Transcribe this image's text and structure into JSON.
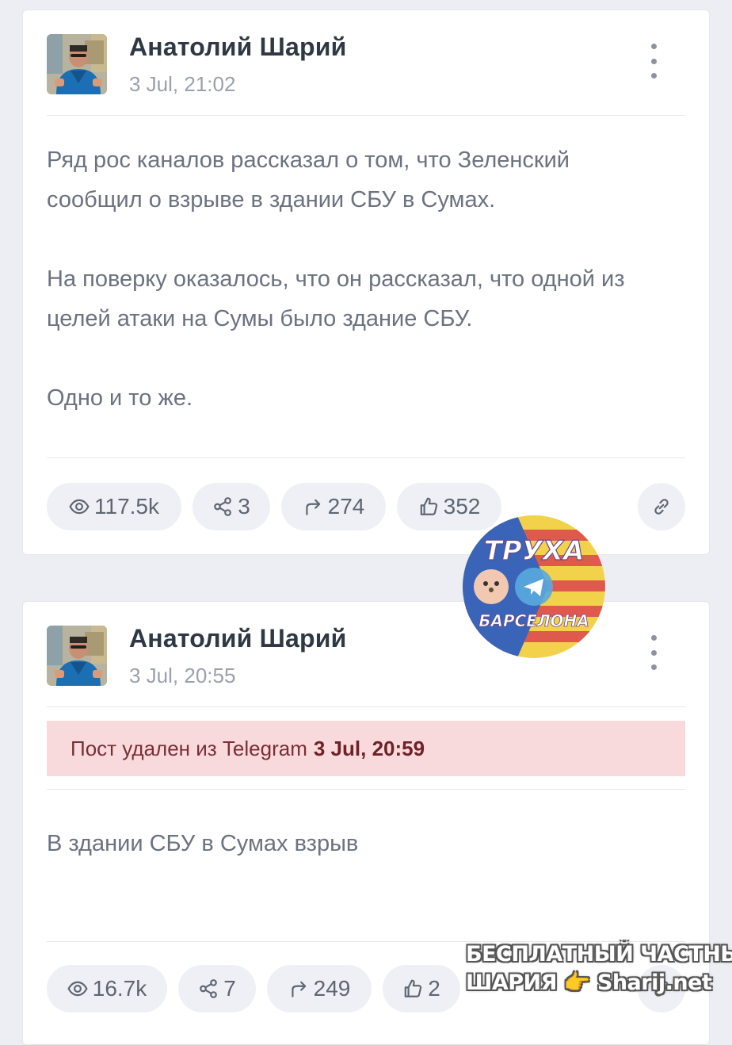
{
  "posts": [
    {
      "author": "Анатолий Шарий",
      "date": "3 Jul, 21:02",
      "paragraphs": [
        "Ряд рос каналов рассказал о том, что Зеленский сообщил о взрыве в здании СБУ в Сумах.",
        "На поверку оказалось, что он рассказал, что одной из целей атаки на Сумы было здание СБУ.",
        "Одно и то же."
      ],
      "stats": {
        "views": "117.5k",
        "shares": "3",
        "forwards": "274",
        "likes": "352"
      }
    },
    {
      "author": "Анатолий Шарий",
      "date": "3 Jul, 20:55",
      "deleted_notice": "Пост удален из Telegram",
      "deleted_time": "3 Jul, 20:59",
      "paragraphs": [
        "В здании СБУ в Сумах взрыв"
      ],
      "stats": {
        "views": "16.7k",
        "shares": "7",
        "forwards": "249",
        "likes": "2"
      }
    }
  ],
  "overlay_badge": {
    "top_text": "ТРУХА",
    "bottom_text": "БАРСЕЛОНА"
  },
  "watermark": {
    "line1": "БЕСПЛАТНЫЙ ЧАСТНЫЙ",
    "line2_left": "ШАРИЯ",
    "line2_right": "Sharij.net"
  },
  "icons": [
    "eye-icon",
    "share-icon",
    "forward-icon",
    "thumbs-up-icon",
    "link-icon",
    "more-vertical-icon",
    "telegram-icon"
  ],
  "colors": {
    "background": "#eceef4",
    "card": "#ffffff",
    "pill": "#eef0f5",
    "deleted_bg": "#f8dadc",
    "deleted_text": "#7b2e35"
  }
}
